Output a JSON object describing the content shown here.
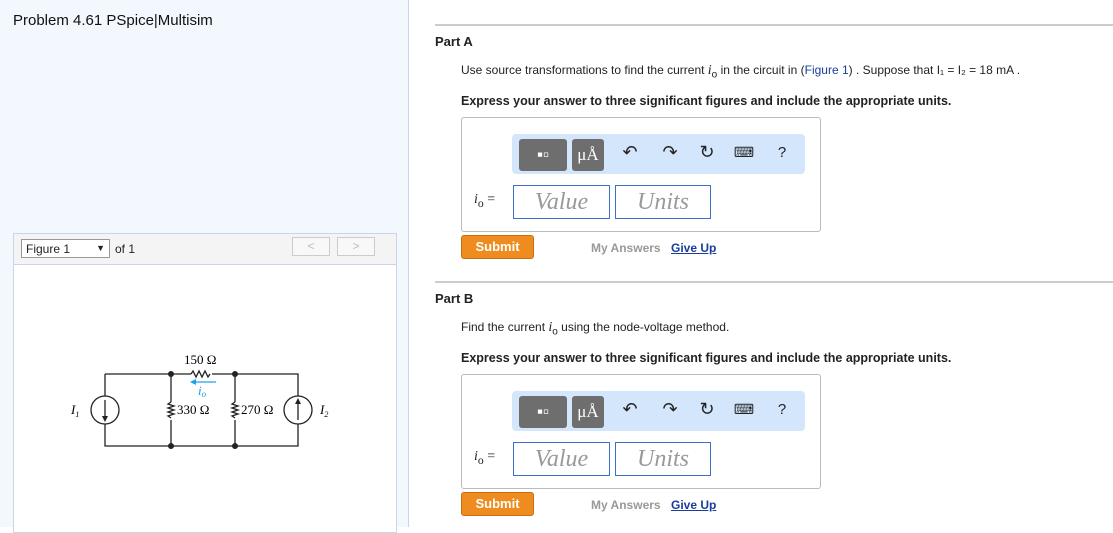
{
  "title": "Problem 4.61 PSpice|Multisim",
  "figure": {
    "select": "Figure 1",
    "of": "of 1",
    "prev": "<",
    "next": ">",
    "labels": {
      "r1": "150 Ω",
      "r2": "330 Ω",
      "r3": "270 Ω",
      "io": "i",
      "io_sub": "o",
      "i1": "I",
      "i1_sub": "1",
      "i2": "I",
      "i2_sub": "2"
    },
    "accent": "#1aa3e8"
  },
  "partA": {
    "heading": "Part A",
    "q_pre": "Use source transformations to find the current ",
    "q_var": "i",
    "q_sub": "o",
    "q_mid": " in the circuit in (",
    "q_link": "Figure 1",
    "q_post": ") . Suppose that I₁ = I₂ = 18 mA .",
    "express": "Express your answer to three significant figures and include the appropriate units.",
    "var": "i",
    "var_sub": "o",
    "eq": "=",
    "value_ph": "Value",
    "units_ph": "Units",
    "submit": "Submit",
    "my_answers": "My Answers",
    "give_up": "Give Up"
  },
  "partB": {
    "heading": "Part B",
    "q_pre": "Find the current ",
    "q_var": "i",
    "q_sub": "o",
    "q_post": " using the node-voltage method.",
    "express": "Express your answer to three significant figures and include the appropriate units.",
    "var": "i",
    "var_sub": "o",
    "eq": "=",
    "value_ph": "Value",
    "units_ph": "Units",
    "submit": "Submit",
    "my_answers": "My Answers",
    "give_up": "Give Up"
  },
  "toolbar": {
    "units_btn": "μÅ",
    "help": "?",
    "icons": [
      "templates-icon",
      "units-icon",
      "undo-icon",
      "redo-icon",
      "reset-icon",
      "keyboard-icon",
      "help-icon"
    ]
  },
  "colors": {
    "submit": "#ef8c1f",
    "toolbar_bg": "#d3e6fb",
    "input_border": "#3d6fc7",
    "link": "#1a3c9c"
  }
}
